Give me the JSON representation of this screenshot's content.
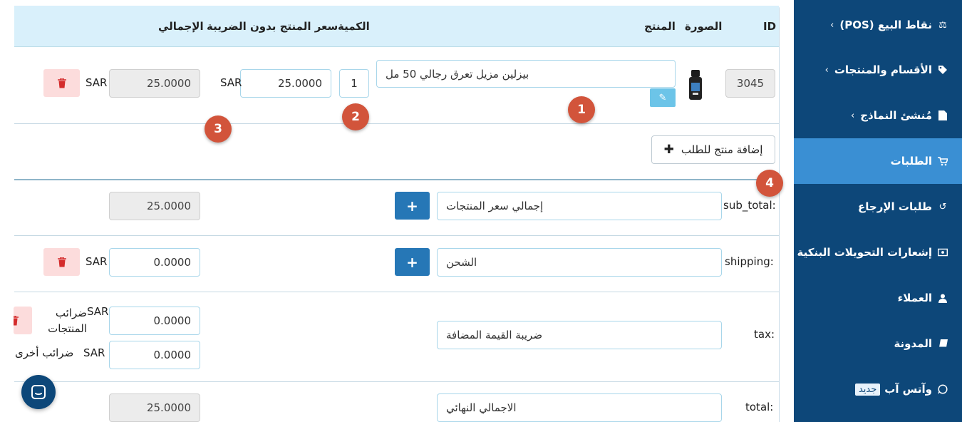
{
  "sidebar": {
    "items": [
      {
        "label": "نقاط البيع (POS)",
        "icon": "scale-icon",
        "chevron": "‹"
      },
      {
        "label": "الأقسام والمنتجات",
        "icon": "tag-icon",
        "chevron": "‹"
      },
      {
        "label": "مُنشئ النماذج",
        "icon": "file-icon",
        "chevron": "‹"
      },
      {
        "label": "الطلبات",
        "icon": "cart-icon"
      },
      {
        "label": "طلبات الإرجاع",
        "icon": "undo-icon"
      },
      {
        "label": "إشعارات التحويلات البنكية",
        "icon": "money-icon"
      },
      {
        "label": "العملاء",
        "icon": "user-icon"
      },
      {
        "label": "المدونة",
        "icon": "book-icon"
      },
      {
        "label": "وآتس آب",
        "icon": "whatsapp-icon",
        "badge": "جديد"
      }
    ],
    "active_index": 3,
    "colors": {
      "background": "#0d4779",
      "active": "#3a8fd3"
    }
  },
  "table": {
    "headers": {
      "id": "ID",
      "image": "الصورة",
      "product": "المنتج",
      "qty": "الكمية",
      "price": "سعر المنتج بدون الضريبة",
      "total": "الإجمالي"
    },
    "row": {
      "id": "3045",
      "product_name": "بيزلين مزيل تعرق رجالي 50 مل",
      "qty": "1",
      "price": "25.0000",
      "currency": "SAR",
      "total": "25.0000"
    }
  },
  "add_product_label": "إضافة منتج للطلب",
  "totals": {
    "sub_total": {
      "key": "sub_total:",
      "label": "إجمالي سعر المنتجات",
      "value": "25.0000"
    },
    "shipping": {
      "key": "shipping:",
      "label": "الشحن",
      "value": "0.0000",
      "currency": "SAR"
    },
    "tax": {
      "key": "tax:",
      "label": "ضريبة القيمة المضافة",
      "product_tax_value": "0.0000",
      "product_tax_label": "ضرائب المنتجات",
      "product_tax_currency": "SAR",
      "other_tax_value": "0.0000",
      "other_tax_label": "ضرائب أخرى",
      "other_tax_currency": "SAR"
    },
    "total": {
      "key": "total:",
      "label": "الاجمالي النهائي",
      "value": "25.0000"
    }
  },
  "markers": [
    "1",
    "2",
    "3",
    "4"
  ],
  "colors": {
    "header_bg": "#d9f0fb",
    "marker": "#d2543b",
    "primary": "#2677b6",
    "danger_bg": "#fcdcdc"
  }
}
